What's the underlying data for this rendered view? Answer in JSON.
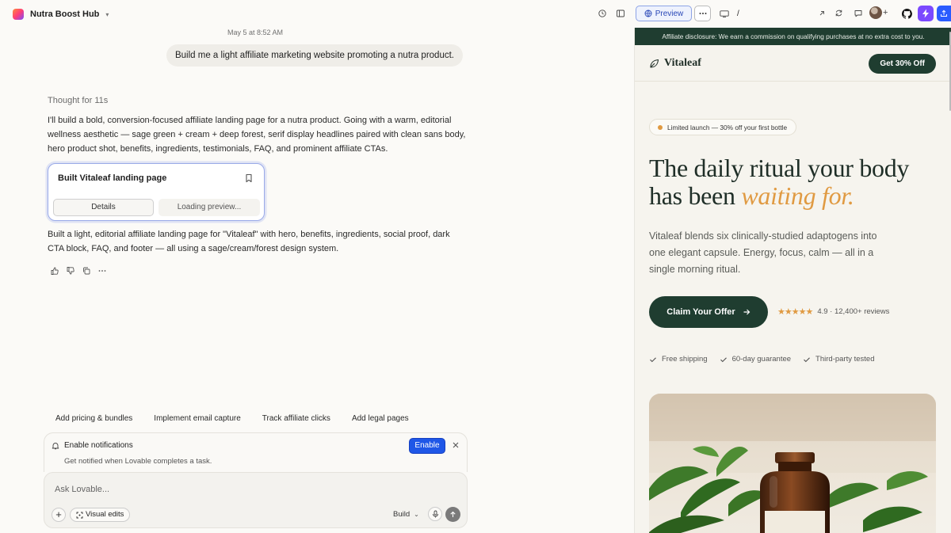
{
  "project": {
    "name": "Nutra Boost Hub"
  },
  "chat": {
    "date": "May 5 at 8:52 AM",
    "user_message": "Build me a light affiliate marketing website promoting a nutra product.",
    "thought": "Thought for 11s",
    "reply_intro": "I'll build a bold, conversion-focused affiliate landing page for a nutra product. Going with a warm, editorial wellness aesthetic — sage green + cream + deep forest, serif display headlines paired with clean sans body, hero product shot, benefits, ingredients, testimonials, FAQ, and prominent affiliate CTAs.",
    "card": {
      "title": "Built Vitaleaf landing page",
      "details_label": "Details",
      "preview_label": "Loading preview..."
    },
    "reply_summary": "Built a light, editorial affiliate landing page for \"Vitaleaf\" with hero, benefits, ingredients, social proof, dark CTA block, FAQ, and footer — all using a sage/cream/forest design system."
  },
  "suggestions": [
    "Add pricing & bundles",
    "Implement email capture",
    "Track affiliate clicks",
    "Add legal pages"
  ],
  "notification": {
    "title": "Enable notifications",
    "description": "Get notified when Lovable completes a task.",
    "enable_label": "Enable"
  },
  "composer": {
    "placeholder": "Ask Lovable...",
    "visual_edits_label": "Visual edits",
    "mode_label": "Build"
  },
  "toolbar": {
    "preview_label": "Preview",
    "url_path": "/"
  },
  "site": {
    "disclosure": "Affiliate disclosure: We earn a commission on qualifying purchases at no extra cost to you.",
    "brand": "Vitaleaf",
    "nav_cta": "Get 30% Off",
    "badge": "Limited launch — 30% off your first bottle",
    "headline_main": "The daily ritual your body has been ",
    "headline_accent": "waiting for.",
    "subhead": "Vitaleaf blends six clinically-studied adaptogens into one elegant capsule. Energy, focus, calm — all in a single morning ritual.",
    "cta": "Claim Your Offer",
    "rating_text": "4.9 · 12,400+ reviews",
    "rating_value": 4.9,
    "features": [
      "Free shipping",
      "60-day guarantee",
      "Third-party tested"
    ]
  },
  "colors": {
    "forest": "#1f3d30",
    "accent": "#e09a42",
    "cream": "#f6f4ee",
    "enable_blue": "#1f57e7",
    "bolt_purple": "#7b49ff"
  }
}
